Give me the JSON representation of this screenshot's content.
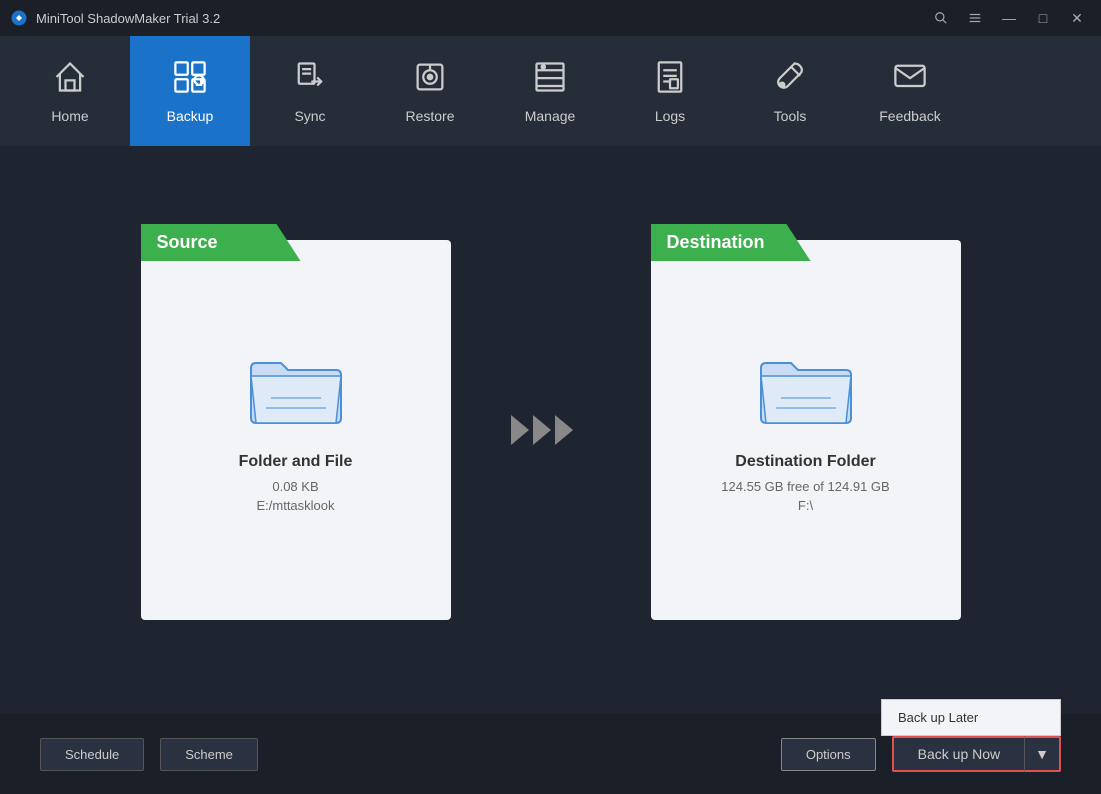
{
  "app": {
    "title": "MiniTool ShadowMaker Trial 3.2"
  },
  "titlebar": {
    "search_label": "🔍",
    "menu_label": "☰",
    "minimize_label": "—",
    "maximize_label": "□",
    "close_label": "✕"
  },
  "nav": {
    "items": [
      {
        "id": "home",
        "label": "Home",
        "active": false
      },
      {
        "id": "backup",
        "label": "Backup",
        "active": true
      },
      {
        "id": "sync",
        "label": "Sync",
        "active": false
      },
      {
        "id": "restore",
        "label": "Restore",
        "active": false
      },
      {
        "id": "manage",
        "label": "Manage",
        "active": false
      },
      {
        "id": "logs",
        "label": "Logs",
        "active": false
      },
      {
        "id": "tools",
        "label": "Tools",
        "active": false
      },
      {
        "id": "feedback",
        "label": "Feedback",
        "active": false
      }
    ]
  },
  "source": {
    "header": "Source",
    "title": "Folder and File",
    "size": "0.08 KB",
    "path": "E:/mttasklook"
  },
  "destination": {
    "header": "Destination",
    "title": "Destination Folder",
    "free": "124.55 GB free of 124.91 GB",
    "path": "F:\\"
  },
  "bottombar": {
    "schedule_label": "Schedule",
    "scheme_label": "Scheme",
    "options_label": "Options",
    "backup_now_label": "Back up Now",
    "backup_later_label": "Back up Later"
  },
  "colors": {
    "active_nav": "#1a73c8",
    "green_header": "#3cb04c",
    "red_border": "#e05050"
  }
}
